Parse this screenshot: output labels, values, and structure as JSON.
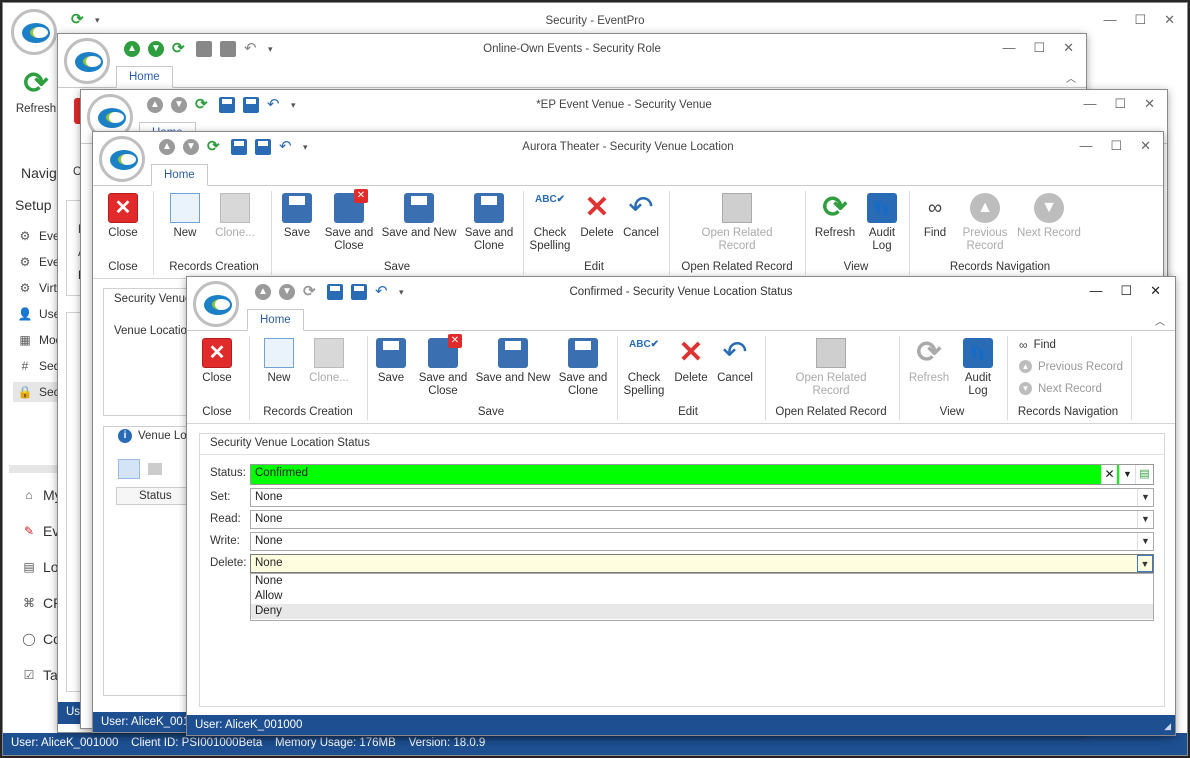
{
  "main_window": {
    "title": "Security - EventPro",
    "refresh_label": "Refresh",
    "partial_label_c": "C",
    "navigation_label": "Navig",
    "setup_label": "Setup",
    "setup_items": [
      "Eve",
      "Eve",
      "Virtu",
      "Use",
      "Mod",
      "Seq",
      "Sec"
    ],
    "bottom_items": [
      "My",
      "Ev",
      "Lo",
      "CR",
      "Co",
      "Ta"
    ],
    "status_text": "User: AliceK_001000    Client ID: PSI001000Beta    Memory Usage: 176MB    Version: 18.0.9",
    "status_fragment": "Use"
  },
  "role_window": {
    "title": "Online-Own Events - Security Role",
    "tab_home": "Home",
    "partial_o": "O",
    "partial_m": "M",
    "partial_a": "A",
    "partial_r": "R"
  },
  "venue_window": {
    "title": "*EP Event Venue - Security Venue",
    "tab_home": "Home"
  },
  "location_window": {
    "title": "Aurora Theater - Security Venue Location",
    "tab_home": "Home",
    "buttons": {
      "close": "Close",
      "new": "New",
      "clone": "Clone...",
      "save": "Save",
      "save_close": "Save and Close",
      "save_new": "Save and New",
      "save_clone": "Save and Clone",
      "spelling": "Check Spelling",
      "delete": "Delete",
      "cancel": "Cancel",
      "related": "Open Related Record",
      "refresh": "Refresh",
      "audit": "Audit Log",
      "find": "Find",
      "previous": "Previous Record",
      "next": "Next Record"
    },
    "groups": {
      "close": "Close",
      "records_creation": "Records Creation",
      "save": "Save",
      "edit": "Edit",
      "related": "Open Related Record",
      "view": "View",
      "navigation": "Records Navigation"
    },
    "panel_title": "Security Venue",
    "venue_location_label": "Venue Location",
    "grid_panel_title": "Venue Loca",
    "grid_col_status": "Status",
    "status_text": "User: AliceK_0010"
  },
  "status_window": {
    "title": "Confirmed - Security Venue Location Status",
    "tab_home": "Home",
    "buttons": {
      "close": "Close",
      "new": "New",
      "clone": "Clone...",
      "save": "Save",
      "save_close": "Save and Close",
      "save_new": "Save and New",
      "save_clone": "Save and Clone",
      "spelling": "Check Spelling",
      "delete": "Delete",
      "cancel": "Cancel",
      "related": "Open Related Record",
      "refresh": "Refresh",
      "audit": "Audit Log",
      "find": "Find",
      "previous": "Previous Record",
      "next": "Next Record"
    },
    "groups": {
      "close": "Close",
      "records_creation": "Records Creation",
      "save": "Save",
      "edit": "Edit",
      "related": "Open Related Record",
      "view": "View",
      "navigation": "Records Navigation"
    },
    "form": {
      "section_title": "Security Venue Location Status",
      "status_label": "Status:",
      "status_value": "Confirmed",
      "status_color": "#00ff00",
      "set_label": "Set:",
      "set_value": "None",
      "read_label": "Read:",
      "read_value": "None",
      "write_label": "Write:",
      "write_value": "None",
      "delete_label": "Delete:",
      "delete_value": "None",
      "delete_options": [
        "None",
        "Allow",
        "Deny"
      ],
      "highlighted_option": "Deny"
    },
    "status_text": "User: AliceK_001000"
  },
  "colors": {
    "statusbar": "#1d4f91",
    "accent": "#2a5ea8"
  }
}
